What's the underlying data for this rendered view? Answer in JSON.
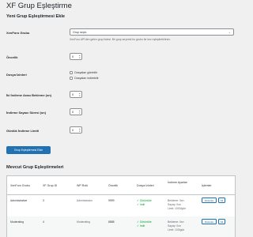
{
  "page": {
    "title": "XF Grup Eşleştirme"
  },
  "add_section": {
    "title": "Yeni Grup Eşleştirmesi Ekle",
    "xf_group": {
      "label": "XenForo Grubu",
      "selected": "Grup seçin",
      "description": "XenForo API'den gelen grup listesi. Bir grup seçerek bu grubu bir kez eşleştirebilirsin."
    },
    "priority": {
      "label": "Öncelik",
      "value": "0"
    },
    "file_permissions": {
      "label": "Dosya İzinleri",
      "options": [
        "Dosyaları görebilir",
        "Dosyaları indirebilir"
      ]
    },
    "download_wait": {
      "label": "İki İndirme Arası Bekleme (sn)",
      "value": "0"
    },
    "download_counter": {
      "label": "İndirme Sayacı Süresi (sn)",
      "value": "0"
    },
    "daily_limit": {
      "label": "Günlük İndirme Limiti",
      "value": "0"
    },
    "submit_label": "Grup Eşleştirmesi Ekle"
  },
  "list_section": {
    "title": "Mevcut Grup Eşleştirmeleri",
    "columns": [
      "XenForo Grubu",
      "XF Grup ID",
      "WP Rolü",
      "Öncelik",
      "Dosya İzinleri",
      "İndirme Ayarları",
      "İşlemler"
    ],
    "rows": [
      {
        "group": "Administrative",
        "id": "3",
        "role": "Administrator",
        "priority": "9999",
        "perm_view": "✓ Görüntüle",
        "perm_download": "✓ İndir",
        "settings": [
          "Bekleme: 0sn",
          "Sayaç: 0sn",
          "Limit: 1000/gün"
        ],
        "edit": "Düzenle",
        "delete": "Sil"
      },
      {
        "group": "Moderating",
        "id": "4",
        "role": "Moderating",
        "priority": "8888",
        "perm_view": "✓ Görüntüle",
        "perm_download": "✓ İndir",
        "settings": [
          "Bekleme: 0sn",
          "Sayaç: 0sn",
          "Limit: 100/gün"
        ],
        "edit": "Düzenle",
        "delete": "Sil"
      }
    ]
  }
}
